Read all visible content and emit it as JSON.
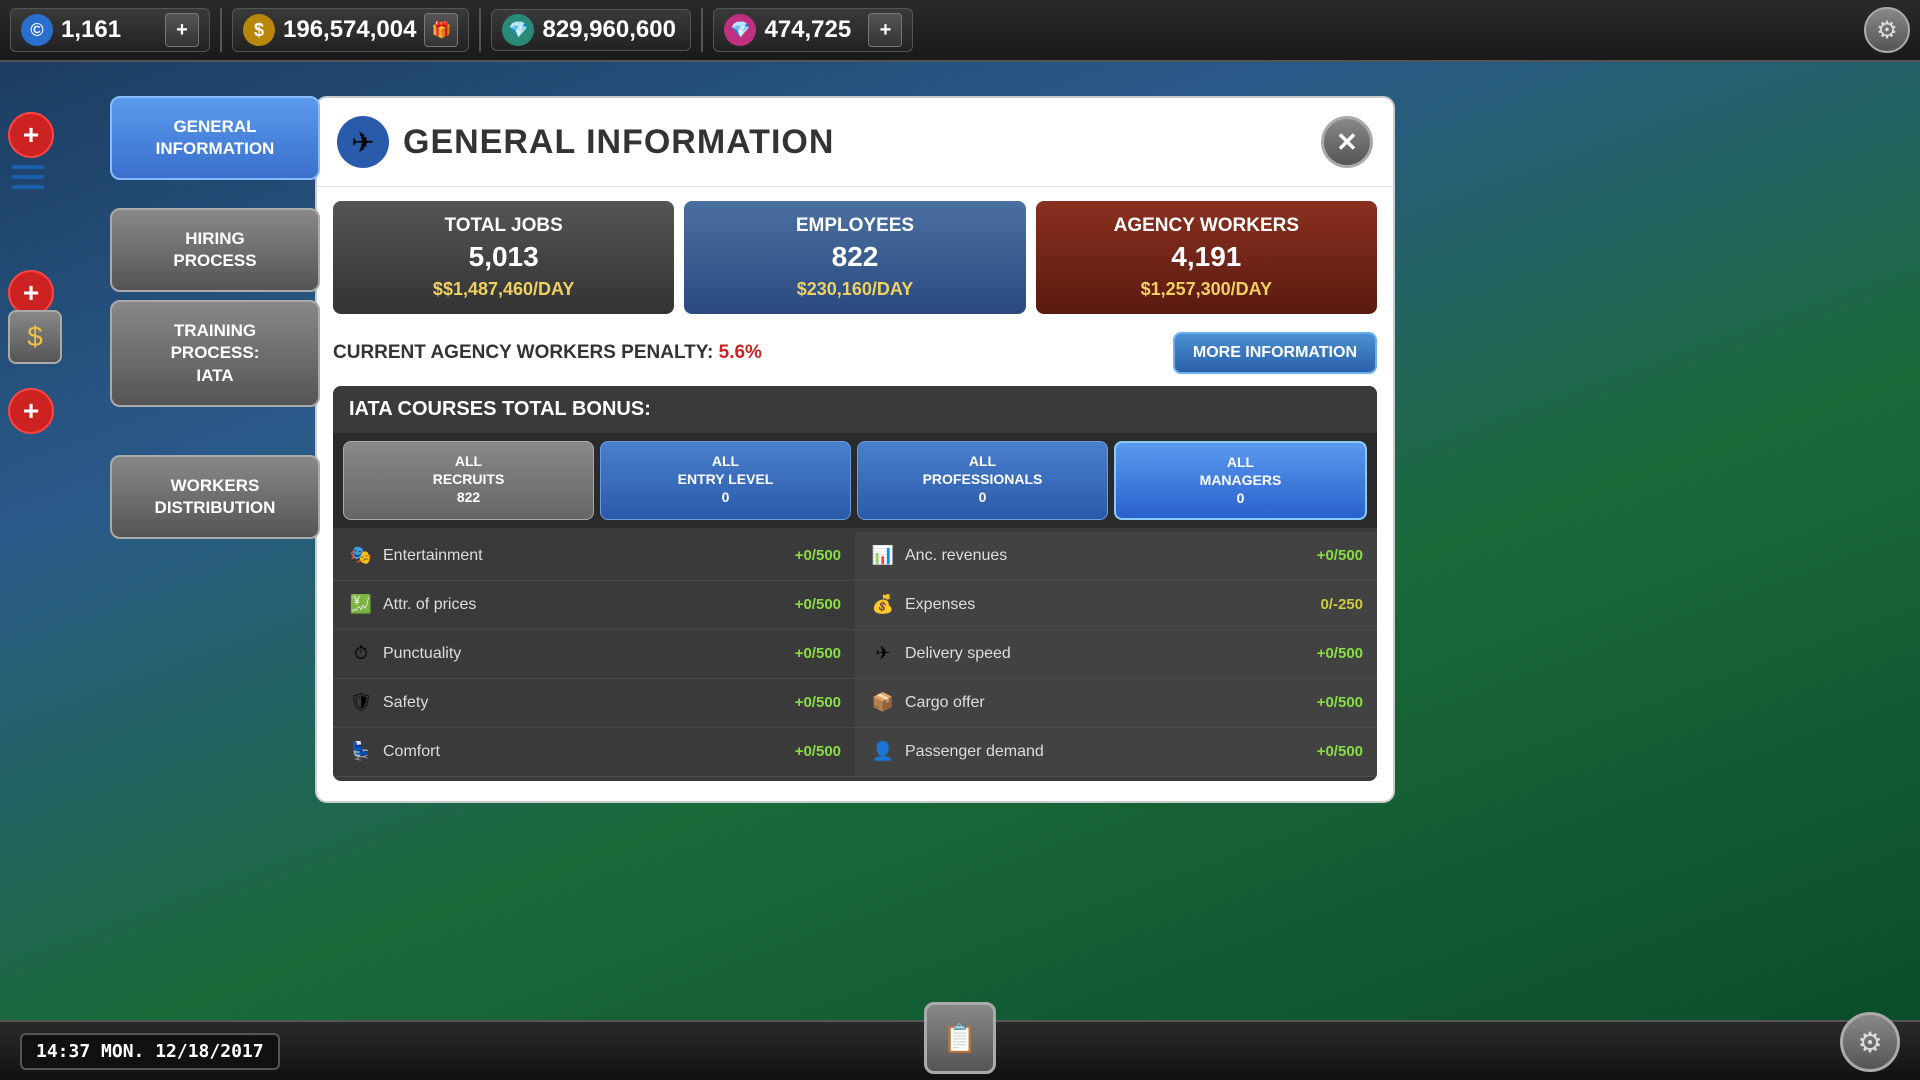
{
  "topbar": {
    "currency_icon": "©",
    "currency_value": "1,161",
    "currency_add": "+",
    "money_icon": "$",
    "money_value": "196,574,004",
    "money_gift": "🎁",
    "gems_icon": "💎",
    "gems_value": "829,960,600",
    "vip_icon": "💎",
    "vip_value": "474,725",
    "vip_add": "+"
  },
  "sidebar": {
    "items": [
      {
        "id": "general-information",
        "label": "GENERAL\nINFORMATION",
        "active": true
      },
      {
        "id": "hiring-process",
        "label": "HIRING\nPROCESS",
        "active": false
      },
      {
        "id": "training-process",
        "label": "TRAINING\nPROCESS:\nIATA",
        "active": false
      },
      {
        "id": "workers-distribution",
        "label": "WORKERS\nDISTRIBUTION",
        "active": false
      }
    ]
  },
  "dialog": {
    "title": "GENERAL INFORMATION",
    "title_icon": "✈",
    "close_icon": "✕",
    "stats": [
      {
        "id": "total-jobs",
        "title": "TOTAL JOBS",
        "value": "5,013",
        "daily": "$1,487,460/DAY",
        "style": "dark"
      },
      {
        "id": "employees",
        "title": "EMPLOYEES",
        "value": "822",
        "daily": "$230,160/DAY",
        "style": "blue"
      },
      {
        "id": "agency-workers",
        "title": "AGENCY WORKERS",
        "value": "4,191",
        "daily": "$1,257,300/DAY",
        "style": "brown"
      }
    ],
    "penalty_label": "CURRENT AGENCY WORKERS PENALTY:",
    "penalty_value": "5.6%",
    "more_info_label": "MORE INFORMATION",
    "iata": {
      "header": "IATA COURSES TOTAL BONUS:",
      "tabs": [
        {
          "id": "all-recruits",
          "label": "ALL\nRECRUITS\n822",
          "style": "gray"
        },
        {
          "id": "all-entry-level",
          "label": "ALL\nENTRY LEVEL\n0",
          "style": "blue"
        },
        {
          "id": "all-professionals",
          "label": "ALL\nPROFESSIONALS\n0",
          "style": "blue"
        },
        {
          "id": "all-managers",
          "label": "ALL\nMANAGERS\n0",
          "style": "active"
        }
      ],
      "skills_left": [
        {
          "icon": "🎭",
          "name": "Entertainment",
          "value": "+0/500"
        },
        {
          "icon": "💹",
          "name": "Attr. of prices",
          "value": "+0/500"
        },
        {
          "icon": "⏱",
          "name": "Punctuality",
          "value": "+0/500"
        },
        {
          "icon": "🛡",
          "name": "Safety",
          "value": "+0/500"
        },
        {
          "icon": "✈",
          "name": "Comfort",
          "value": "+0/500"
        }
      ],
      "skills_right": [
        {
          "icon": "📊",
          "name": "Anc. revenues",
          "value": "+0/500"
        },
        {
          "icon": "💰",
          "name": "Expenses",
          "value": "0/-250"
        },
        {
          "icon": "✈",
          "name": "Delivery speed",
          "value": "+0/500"
        },
        {
          "icon": "📦",
          "name": "Cargo offer",
          "value": "+0/500"
        },
        {
          "icon": "👤",
          "name": "Passenger demand",
          "value": "+0/500"
        }
      ]
    }
  },
  "bottom": {
    "datetime": "14:37 MON. 12/18/2017"
  }
}
